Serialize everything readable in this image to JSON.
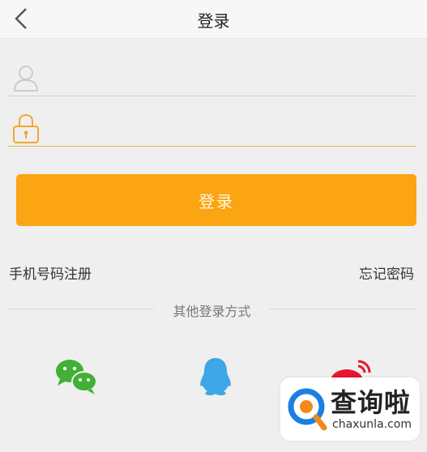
{
  "header": {
    "title": "登录",
    "back_icon": "chevron-left-icon"
  },
  "form": {
    "username": {
      "icon": "user-icon",
      "value": "",
      "placeholder": ""
    },
    "password": {
      "icon": "lock-icon",
      "value": "",
      "placeholder": ""
    },
    "login_label": "登录"
  },
  "links": {
    "register": "手机号码注册",
    "forgot": "忘记密码"
  },
  "other_login": {
    "label": "其他登录方式",
    "providers": [
      {
        "icon": "wechat-icon",
        "color": "#41b035"
      },
      {
        "icon": "qq-icon",
        "color": "#3ea7e8"
      },
      {
        "icon": "weibo-icon",
        "color": "#e6162d"
      }
    ]
  },
  "watermark": {
    "text_cn": "查询啦",
    "text_en": "chaxunla.com"
  },
  "colors": {
    "accent": "#fba512",
    "background": "#efefef"
  }
}
